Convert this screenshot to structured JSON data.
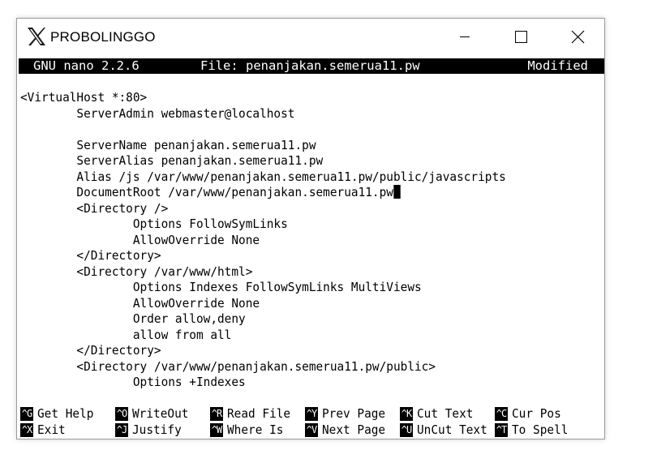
{
  "window": {
    "title": "PROBOLINGGO",
    "controls": {
      "minimize": "minimize-icon",
      "maximize": "maximize-icon",
      "close": "close-icon"
    }
  },
  "nano": {
    "version": "GNU nano 2.2.6",
    "file": "File: penanjakan.semerua11.pw",
    "status": "Modified"
  },
  "editor": {
    "lines": [
      "<VirtualHost *:80>",
      "        ServerAdmin webmaster@localhost",
      "",
      "        ServerName penanjakan.semerua11.pw",
      "        ServerAlias penanjakan.semerua11.pw",
      "        Alias /js /var/www/penanjakan.semerua11.pw/public/javascripts",
      "        DocumentRoot /var/www/penanjakan.semerua11.pw",
      "        <Directory />",
      "                Options FollowSymLinks",
      "                AllowOverride None",
      "        </Directory>",
      "        <Directory /var/www/html>",
      "                Options Indexes FollowSymLinks MultiViews",
      "                AllowOverride None",
      "                Order allow,deny",
      "                allow from all",
      "        </Directory>",
      "        <Directory /var/www/penanjakan.semerua11.pw/public>",
      "                Options +Indexes"
    ],
    "cursor_line": 6
  },
  "shortcuts": [
    {
      "key": "^G",
      "label": "Get Help"
    },
    {
      "key": "^O",
      "label": "WriteOut"
    },
    {
      "key": "^R",
      "label": "Read File"
    },
    {
      "key": "^Y",
      "label": "Prev Page"
    },
    {
      "key": "^K",
      "label": "Cut Text"
    },
    {
      "key": "^C",
      "label": "Cur Pos"
    },
    {
      "key": "^X",
      "label": "Exit"
    },
    {
      "key": "^J",
      "label": "Justify"
    },
    {
      "key": "^W",
      "label": "Where Is"
    },
    {
      "key": "^V",
      "label": "Next Page"
    },
    {
      "key": "^U",
      "label": "UnCut Text"
    },
    {
      "key": "^T",
      "label": "To Spell"
    }
  ]
}
